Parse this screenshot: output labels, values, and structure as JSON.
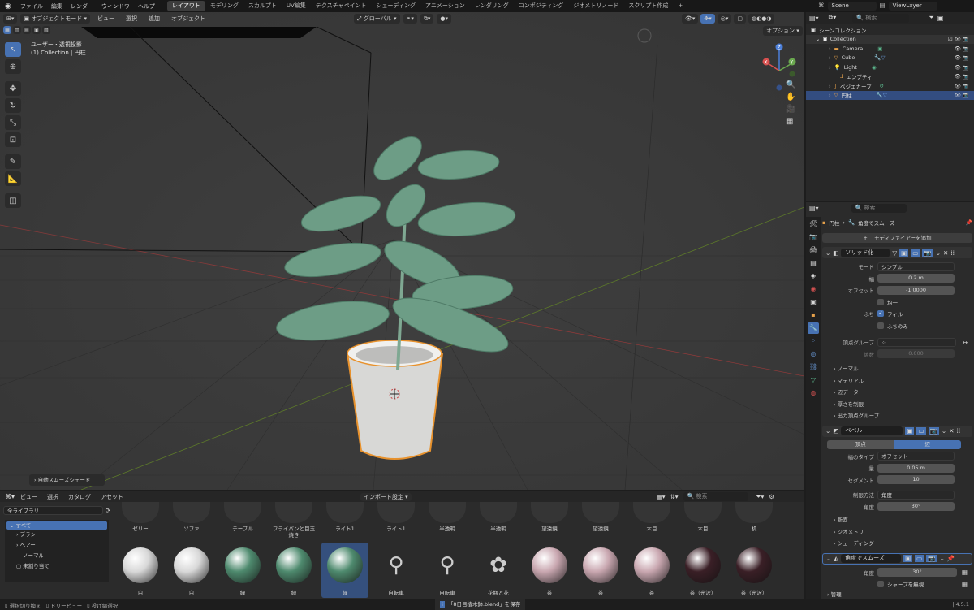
{
  "topbar": {
    "menus": [
      "ファイル",
      "編集",
      "レンダー",
      "ウィンドウ",
      "ヘルプ"
    ],
    "workspaces": [
      "レイアウト",
      "モデリング",
      "スカルプト",
      "UV編集",
      "テクスチャペイント",
      "シェーディング",
      "アニメーション",
      "レンダリング",
      "コンポジティング",
      "ジオメトリノード",
      "スクリプト作成"
    ],
    "active_workspace": "レイアウト",
    "add_tab": "+",
    "scene": "Scene",
    "view_layer": "ViewLayer"
  },
  "viewport": {
    "mode": "オブジェクトモード",
    "menus": [
      "ビュー",
      "選択",
      "追加",
      "オブジェクト"
    ],
    "orientation": "グローバル",
    "options": "オプション",
    "view_name": "ユーザー・透視投影",
    "collection_info": "(1) Collection | 円柱",
    "operator_panel": "自動スムーズシェード",
    "gizmo_axes": [
      "X",
      "Y",
      "Z"
    ]
  },
  "outliner": {
    "search_placeholder": "検索",
    "root": "シーンコレクション",
    "collection": "Collection",
    "items": [
      {
        "name": "Camera",
        "icon": "camera-icon",
        "color": "#e5a04a",
        "selected": false
      },
      {
        "name": "Cube",
        "icon": "mesh-icon",
        "color": "#e5a04a",
        "selected": false
      },
      {
        "name": "Light",
        "icon": "light-icon",
        "color": "#e5a04a",
        "selected": false
      },
      {
        "name": "エンプティ",
        "icon": "empty-icon",
        "color": "#e5a04a",
        "selected": false
      },
      {
        "name": "ベジエカーブ",
        "icon": "curve-icon",
        "color": "#e5a04a",
        "selected": false
      },
      {
        "name": "円柱",
        "icon": "mesh-icon",
        "color": "#e5a04a",
        "selected": true
      }
    ]
  },
  "properties": {
    "search_placeholder": "検索",
    "breadcrumb_object": "円柱",
    "breadcrumb_modifier": "角度でスムーズ",
    "add_modifier": "モディファイアーを追加",
    "solidify": {
      "name": "ソリッド化",
      "mode_label": "モード",
      "mode_value": "シンプル",
      "width_label": "幅",
      "width_value": "0.2 m",
      "offset_label": "オフセット",
      "offset_value": "-1.0000",
      "even_label": "均一",
      "rim_label": "ふち",
      "fill_label": "フィル",
      "rim_only_label": "ふちのみ",
      "vgroup_label": "頂点グループ",
      "factor_label": "係数",
      "factor_value": "0.000",
      "subpanels": [
        "ノーマル",
        "マテリアル",
        "辺データ",
        "厚さを制限",
        "出力頂点グループ"
      ]
    },
    "bevel": {
      "name": "ベベル",
      "tab_vertices": "頂点",
      "tab_edges": "辺",
      "width_type_label": "幅のタイプ",
      "width_type_value": "オフセット",
      "amount_label": "量",
      "amount_value": "0.05 m",
      "segments_label": "セグメント",
      "segments_value": "10",
      "limit_label": "制限方法",
      "limit_value": "角度",
      "angle_label": "角度",
      "angle_value": "30°",
      "subpanels": [
        "断面",
        "ジオメトリ",
        "シェーディング"
      ]
    },
    "smooth": {
      "name": "角度でスムーズ",
      "angle_label": "角度",
      "angle_value": "30°",
      "ignore_sharp": "シャープを無視",
      "manage": "管理"
    }
  },
  "asset_browser": {
    "menus": [
      "ビュー",
      "選択",
      "カタログ",
      "アセット"
    ],
    "import": "インポート設定",
    "search_placeholder": "検索",
    "library": "全ライブラリ",
    "tree": [
      "すべて",
      "ブラシ",
      "ヘアー",
      "ノーマル",
      "未割り当て"
    ],
    "row1": [
      "ゼリー",
      "ソファ",
      "テーブル",
      "フライパンと目玉焼き",
      "ライト1",
      "ライト1",
      "半透明",
      "半透明",
      "望遠鏡",
      "望遠鏡",
      "木目",
      "木目",
      "机"
    ],
    "row2": [
      {
        "label": "白",
        "color": "#d8d8d8"
      },
      {
        "label": "白",
        "color": "#d8d8d8"
      },
      {
        "label": "緑",
        "color": "#4e8a6e"
      },
      {
        "label": "緑",
        "color": "#4e8a6e"
      },
      {
        "label": "緑",
        "color": "#4e8a6e"
      },
      {
        "label": "自転車",
        "color": ""
      },
      {
        "label": "自転車",
        "color": ""
      },
      {
        "label": "花瓶と花",
        "color": ""
      },
      {
        "label": "茶",
        "color": "#c9a7b0"
      },
      {
        "label": "茶",
        "color": "#c9a7b0"
      },
      {
        "label": "茶",
        "color": "#c9a7b0"
      },
      {
        "label": "茶（光沢）",
        "color": "#3a1f26"
      },
      {
        "label": "茶（光沢）",
        "color": "#3a1f26"
      }
    ]
  },
  "statusbar": {
    "left": [
      "選択切り換え",
      "ドリーピュー",
      "投げ縄選択"
    ],
    "message": "「8日目植木鉢.blend」を保存",
    "version": "4.5.1"
  }
}
